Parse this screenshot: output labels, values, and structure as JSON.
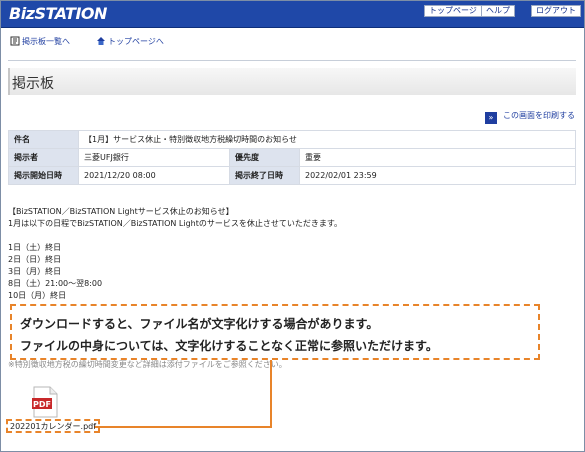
{
  "header": {
    "logo": "BizSTATION",
    "buttons": [
      "トップページ",
      "ヘルプ",
      "ログアウト"
    ]
  },
  "nav": {
    "back_to_list": "掲示板一覧へ",
    "to_top": "トップページへ"
  },
  "page_title": "掲示板",
  "print_link": "この画面を印刷する",
  "table": {
    "subject_label": "件名",
    "subject_value": "【1月】サービス休止・特別徴収地方税繰切時間のお知らせ",
    "poster_label": "掲示者",
    "poster_value": "三菱UFJ銀行",
    "priority_label": "優先度",
    "priority_value": "重要",
    "start_label": "掲示開始日時",
    "start_value": "2021/12/20 08:00",
    "end_label": "掲示終了日時",
    "end_value": "2022/02/01 23:59"
  },
  "body_lines": [
    "【BizSTATION／BizSTATION Lightサービス休止のお知らせ】",
    "1月は以下の日程でBizSTATION／BizSTATION Lightのサービスを休止させていただきます。",
    "",
    "1日（土）終日",
    "2日（日）終日",
    "3日（月）終日",
    "8日（土）21:00～翌8:00",
    "10日（月）終日"
  ],
  "callout": {
    "line1": "ダウンロードすると、ファイル名が文字化けする場合があります。",
    "line2": "ファイルの中身については、文字化けすることなく正常に参照いただけます。"
  },
  "hidden_note": "※特別徴収地方税の繰切時間変更など詳細は添付ファイルをご参照ください。",
  "attachment": {
    "icon_text": "PDF",
    "filename": "202201カレンダー.pdf"
  },
  "colors": {
    "header_bg": "#1f48a8",
    "accent_orange": "#e8842a",
    "link_blue": "#1f3ea0"
  }
}
